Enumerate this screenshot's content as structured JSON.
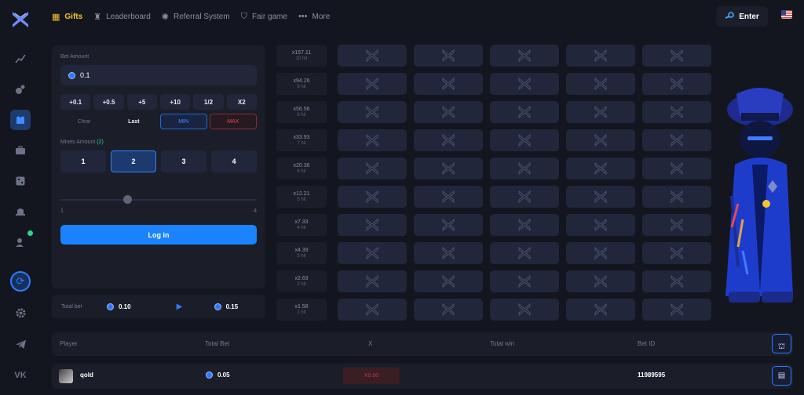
{
  "nav": {
    "items": [
      {
        "label": "Gifts",
        "icon": "gift-icon"
      },
      {
        "label": "Leaderboard",
        "icon": "trophy-icon"
      },
      {
        "label": "Referral System",
        "icon": "gear-icon"
      },
      {
        "label": "Fair game",
        "icon": "shield-icon"
      },
      {
        "label": "More",
        "icon": "dots-icon"
      }
    ],
    "enter_label": "Enter"
  },
  "bet": {
    "label": "Bet Amount",
    "value": "0.1",
    "quick": [
      "+0.1",
      "+0.5",
      "+5",
      "+10",
      "1/2",
      "X2"
    ],
    "clear": "Clear",
    "last": "Last",
    "min": "MIN",
    "max": "MAX"
  },
  "mines": {
    "label": "Mines Amount",
    "count": "(2)",
    "options": [
      "1",
      "2",
      "3",
      "4"
    ],
    "selected": "2",
    "slider_min": "1",
    "slider_max": "4"
  },
  "login_label": "Log in",
  "totals": {
    "label": "Total bet",
    "bet": "0.10",
    "win": "0.15"
  },
  "multipliers": [
    {
      "mult": "x157.11",
      "hits": "10 hit"
    },
    {
      "mult": "x94.26",
      "hits": "9 hit"
    },
    {
      "mult": "x56.56",
      "hits": "8 hit"
    },
    {
      "mult": "x33.93",
      "hits": "7 hit"
    },
    {
      "mult": "x20.36",
      "hits": "6 hit"
    },
    {
      "mult": "x12.21",
      "hits": "5 hit"
    },
    {
      "mult": "x7.33",
      "hits": "4 hit"
    },
    {
      "mult": "x4.39",
      "hits": "3 hit"
    },
    {
      "mult": "x2.63",
      "hits": "2 hit"
    },
    {
      "mult": "x1.58",
      "hits": "1 hit"
    }
  ],
  "table": {
    "headers": [
      "Player",
      "Total Bet",
      "X",
      "Total win",
      "Bet ID"
    ],
    "rows": [
      {
        "player": "qold",
        "total_bet": "0.05",
        "x": "X0.00",
        "total_win": "",
        "bet_id": "11989595"
      }
    ]
  },
  "colors": {
    "accent": "#1b83ff",
    "gold": "#f5c431",
    "danger": "#e04a5b"
  }
}
